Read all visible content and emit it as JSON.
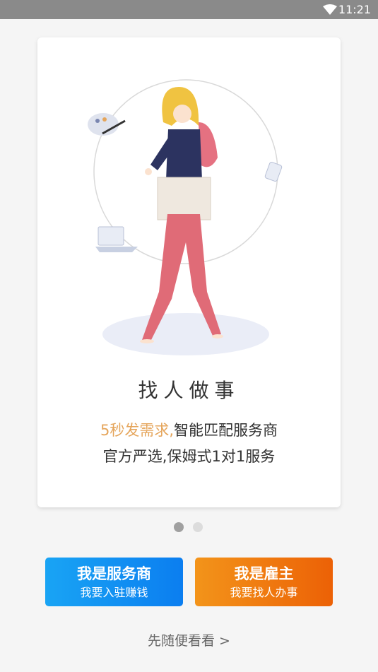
{
  "status_bar": {
    "time": "11:21"
  },
  "card": {
    "title": "找人做事",
    "line1_highlight": "5秒发需求,",
    "line1_rest": "智能匹配服务商",
    "line2": "官方严选,保姆式1对1服务"
  },
  "pager": {
    "active_index": 0,
    "count": 2
  },
  "buttons": {
    "provider": {
      "main": "我是服务商",
      "sub": "我要入驻赚钱"
    },
    "employer": {
      "main": "我是雇主",
      "sub": "我要找人办事"
    }
  },
  "browse_link": "先随便看看 >",
  "colors": {
    "highlight": "#e5a55b",
    "provider_blue": "#0b7ef0",
    "employer_orange": "#ec6106"
  }
}
